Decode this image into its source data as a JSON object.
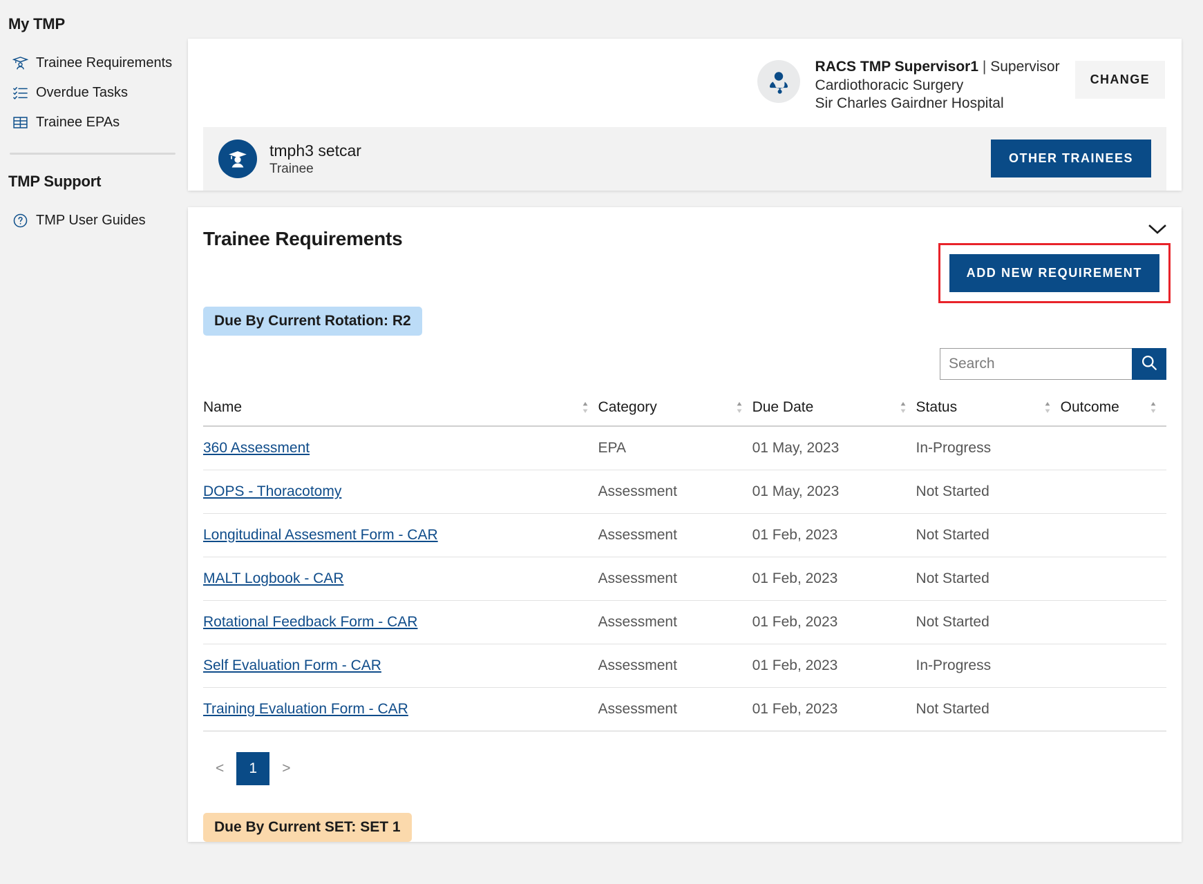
{
  "sidebar": {
    "groups": [
      {
        "title": "My TMP",
        "items": [
          {
            "label": "Trainee Requirements",
            "icon": "graduate-icon"
          },
          {
            "label": "Overdue Tasks",
            "icon": "checklist-icon"
          },
          {
            "label": "Trainee EPAs",
            "icon": "table-icon"
          }
        ]
      },
      {
        "title": "TMP Support",
        "items": [
          {
            "label": "TMP User Guides",
            "icon": "question-circle-icon"
          }
        ]
      }
    ]
  },
  "supervisor": {
    "name": "RACS TMP Supervisor1",
    "separator": "|",
    "role": "Supervisor",
    "specialty": "Cardiothoracic Surgery",
    "hospital": "Sir Charles Gairdner Hospital",
    "change_label": "CHANGE",
    "avatar_icon": "doctor-avatar-icon"
  },
  "trainee": {
    "name": "tmph3 setcar",
    "role": "Trainee",
    "other_trainees_label": "OTHER TRAINEES",
    "avatar_icon": "graduate-avatar-icon"
  },
  "requirements": {
    "title": "Trainee Requirements",
    "collapse_icon": "chevron-down-icon",
    "add_label": "ADD NEW REQUIREMENT",
    "highlight_color": "#e8232a",
    "accent_color": "#0a4b87",
    "rotation_badge": "Due By Current Rotation:  R2",
    "rotation_badge_color": "#bcdcf7",
    "set_badge": "Due By Current SET:  SET 1",
    "set_badge_color": "#fbd9ac",
    "search": {
      "value": "",
      "placeholder": "Search",
      "icon": "search-icon"
    },
    "columns": [
      "Name",
      "Category",
      "Due Date",
      "Status",
      "Outcome"
    ],
    "rows": [
      {
        "name": "360 Assessment",
        "category": "EPA",
        "due": "01 May, 2023",
        "status": "In-Progress",
        "outcome": ""
      },
      {
        "name": "DOPS - Thoracotomy",
        "category": "Assessment",
        "due": "01 May, 2023",
        "status": "Not Started",
        "outcome": ""
      },
      {
        "name": "Longitudinal Assesment Form - CAR",
        "category": "Assessment",
        "due": "01 Feb, 2023",
        "status": "Not Started",
        "outcome": ""
      },
      {
        "name": "MALT Logbook - CAR",
        "category": "Assessment",
        "due": "01 Feb, 2023",
        "status": "Not Started",
        "outcome": ""
      },
      {
        "name": "Rotational Feedback Form - CAR",
        "category": "Assessment",
        "due": "01 Feb, 2023",
        "status": "Not Started",
        "outcome": ""
      },
      {
        "name": "Self Evaluation Form - CAR",
        "category": "Assessment",
        "due": "01 Feb, 2023",
        "status": "In-Progress",
        "outcome": ""
      },
      {
        "name": "Training Evaluation Form - CAR",
        "category": "Assessment",
        "due": "01 Feb, 2023",
        "status": "Not Started",
        "outcome": ""
      }
    ],
    "pagination": {
      "prev": "<",
      "next": ">",
      "current": "1"
    }
  }
}
